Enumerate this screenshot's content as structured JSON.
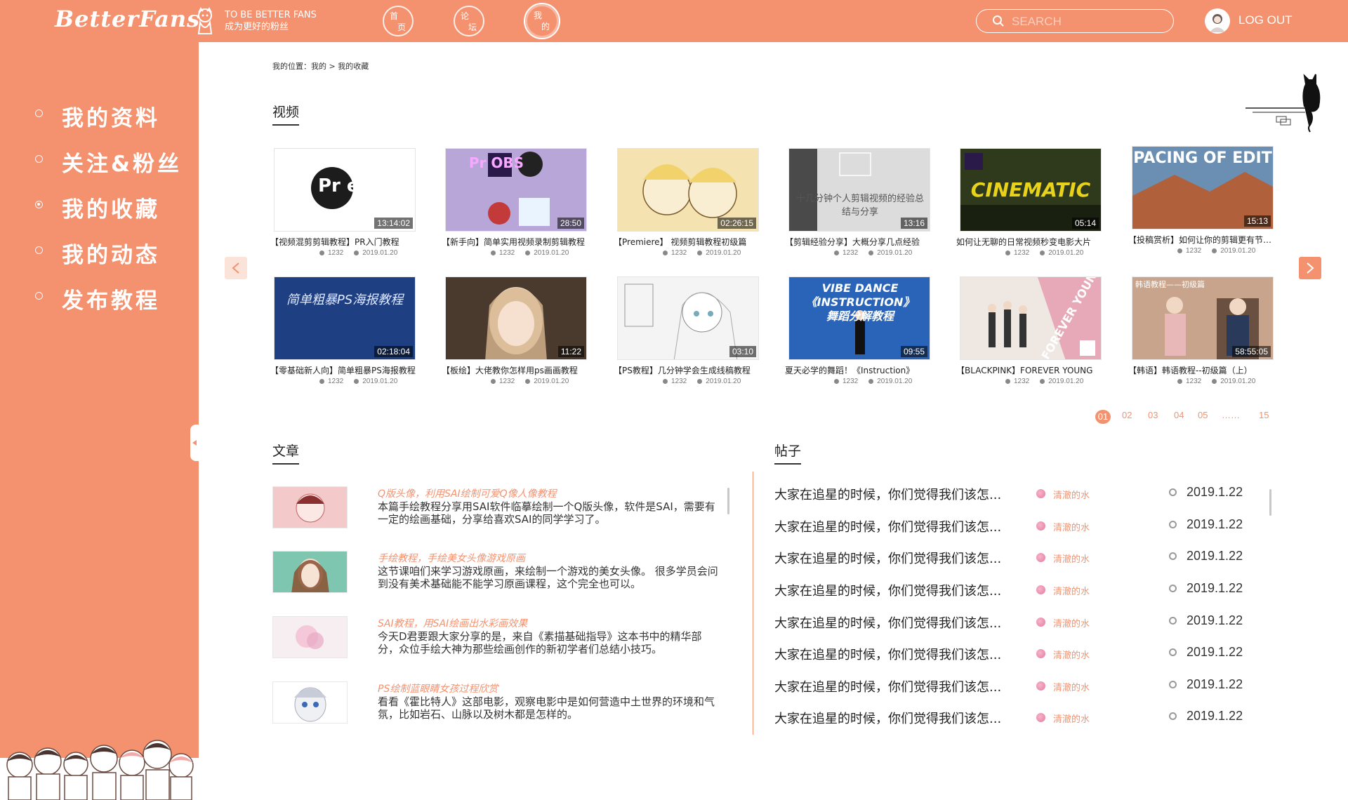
{
  "header": {
    "logo": "BetterFans",
    "tagline_en": "TO BE BETTER FANS",
    "tagline_cn": "成为更好的粉丝",
    "nav": [
      {
        "c1": "首",
        "c2": "页"
      },
      {
        "c1": "论",
        "c2": "坛"
      },
      {
        "c1": "我",
        "c2": "的"
      }
    ],
    "active_nav_index": 2,
    "search_placeholder": "SEARCH",
    "logout": "LOG OUT"
  },
  "sidebar": {
    "items": [
      "我的资料",
      "关注&粉丝",
      "我的收藏",
      "我的动态",
      "发布教程"
    ],
    "active_index": 2
  },
  "breadcrumb": "我的位置：我的 > 我的收藏",
  "videos": {
    "title": "视频",
    "items": [
      {
        "title": "【视频混剪剪辑教程】PR入门教程",
        "duration": "13:14:02",
        "views": "1232",
        "date": "2019.01.20",
        "thumb_text": "Pr easy",
        "thumb_color": "#ffffff"
      },
      {
        "title": "【新手向】简单实用视频录制剪辑教程",
        "duration": "28:50",
        "views": "1232",
        "date": "2019.01.20",
        "thumb_text": "Pr  OBS",
        "thumb_color": "#b9a6d8"
      },
      {
        "title": "【Premiere】 视频剪辑教程初级篇",
        "duration": "02:26:15",
        "views": "1232",
        "date": "2019.01.20",
        "thumb_text": "",
        "thumb_color": "#f4e3b0"
      },
      {
        "title": "【剪辑经验分享】大概分享几点经验",
        "duration": "13:16",
        "views": "1232",
        "date": "2019.01.20",
        "thumb_text": "十几分钟个人剪辑视频的经验总结与分享",
        "thumb_color": "#d9d9d9"
      },
      {
        "title": "如何让无聊的日常视频秒变电影大片",
        "duration": "05:14",
        "views": "1232",
        "date": "2019.01.20",
        "thumb_text": "CINEMATIC",
        "thumb_color": "#2f3a1c"
      },
      {
        "title": "【投稿赏析】如何让你的剪辑更有节奏感",
        "duration": "15:13",
        "views": "1232",
        "date": "2019.01.20",
        "thumb_text": "PACING OF EDIT",
        "thumb_color": "#6b8fb3"
      },
      {
        "title": "【零基础新人向】简单粗暴PS海报教程",
        "duration": "02:18:04",
        "views": "1232",
        "date": "2019.01.20",
        "thumb_text": "简单粗暴PS海报教程",
        "thumb_color": "#1f3f83"
      },
      {
        "title": "【板绘】大佬教你怎样用ps画画教程",
        "duration": "11:22",
        "views": "1232",
        "date": "2019.01.20",
        "thumb_text": "",
        "thumb_color": "#4a3a2e"
      },
      {
        "title": "【PS教程】几分钟学会生成线稿教程",
        "duration": "03:10",
        "views": "1232",
        "date": "2019.01.20",
        "thumb_text": "",
        "thumb_color": "#f2f2f2"
      },
      {
        "title": "夏天必学的舞蹈！《Instruction》",
        "duration": "09:55",
        "views": "1232",
        "date": "2019.01.20",
        "thumb_text": "VIBE DANCE 《INSTRUCTION》舞蹈分解教程",
        "thumb_color": "#2a64b8"
      },
      {
        "title": "【BLACKPINK】FOREVER YOUNG",
        "duration": "",
        "views": "1232",
        "date": "2019.01.20",
        "thumb_text": "FOREVER YOUNG",
        "thumb_color": "#e7a9b8"
      },
      {
        "title": "【韩语】韩语教程--初级篇（上）",
        "duration": "58:55:05",
        "views": "1232",
        "date": "2019.01.20",
        "thumb_text": "韩语教程——初级篇",
        "thumb_color": "#c8a48c"
      }
    ]
  },
  "pagination": {
    "pages": [
      "01",
      "02",
      "03",
      "04",
      "05"
    ],
    "ellipsis": "……",
    "last": "15",
    "active": "01"
  },
  "articles": {
    "title": "文章",
    "items": [
      {
        "title": "Q版头像，利用SAI绘制可爱Q像人像教程",
        "desc": "本篇手绘教程分享用SAI软件临摹绘制一个Q版头像，软件是SAI，需要有一定的绘画基础，分享给喜欢SAI的同学学习了。",
        "color": "#f3c9c9"
      },
      {
        "title": "手绘教程，手绘美女头像游戏原画",
        "desc": "这节课咱们来学习游戏原画，来绘制一个游戏的美女头像。 很多学员会问到没有美术基础能不能学习原画课程，这个完全也可以。",
        "color": "#7fc6b0"
      },
      {
        "title": "SAI教程，用SAI绘画出水彩画效果",
        "desc": "今天D君要跟大家分享的是，来自《素描基础指导》这本书中的精华部分，众位手绘大神为那些绘画创作的新初学者们总结小技巧。",
        "color": "#f4dbe6"
      },
      {
        "title": "PS绘制蓝眼睛女孩过程欣赏",
        "desc": "看看《霍比特人》这部电影，观察电影中是如何营造中土世界的环境和气氛，比如岩石、山脉以及树木都是怎样的。",
        "color": "#e2e6ef"
      }
    ]
  },
  "posts": {
    "title": "帖子",
    "items": [
      {
        "text": "大家在追星的时候，你们觉得我们该怎...",
        "tag": "清澈的水",
        "date": "2019.1.22"
      },
      {
        "text": "大家在追星的时候，你们觉得我们该怎...",
        "tag": "清澈的水",
        "date": "2019.1.22"
      },
      {
        "text": "大家在追星的时候，你们觉得我们该怎...",
        "tag": "清澈的水",
        "date": "2019.1.22"
      },
      {
        "text": "大家在追星的时候，你们觉得我们该怎...",
        "tag": "清澈的水",
        "date": "2019.1.22"
      },
      {
        "text": "大家在追星的时候，你们觉得我们该怎...",
        "tag": "清澈的水",
        "date": "2019.1.22"
      },
      {
        "text": "大家在追星的时候，你们觉得我们该怎...",
        "tag": "清澈的水",
        "date": "2019.1.22"
      },
      {
        "text": "大家在追星的时候，你们觉得我们该怎...",
        "tag": "清澈的水",
        "date": "2019.1.22"
      },
      {
        "text": "大家在追星的时候，你们觉得我们该怎...",
        "tag": "清澈的水",
        "date": "2019.1.22"
      }
    ]
  },
  "colors": {
    "accent": "#f4926f",
    "accent_light": "#fbe3da"
  },
  "icons": [
    "search-icon",
    "avatar-icon",
    "chevron-left-icon",
    "chevron-right-icon",
    "clock-icon",
    "eye-icon",
    "cat-icon"
  ]
}
